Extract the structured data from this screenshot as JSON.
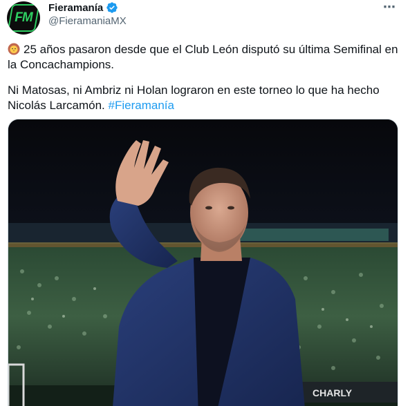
{
  "author": {
    "display_name": "Fieramanía",
    "handle": "@FieramaniaMX",
    "avatar_text": "FM",
    "verified": true
  },
  "tweet": {
    "paragraph1": "25 años pasaron desde que el Club León disputó su última Semifinal en la Concachampions.",
    "paragraph2_text": "Ni Matosas, ni Ambriz ni Holan lograron en este torneo lo que ha hecho Nicolás Larcamón. ",
    "hashtag": "#Fieramanía"
  },
  "media": {
    "banner_text": "CHARLY"
  },
  "icons": {
    "more": "more-icon",
    "verified": "verified-badge-icon",
    "emoji": "lion-face-emoji"
  },
  "colors": {
    "link": "#1d9bf0",
    "secondary_text": "#536471",
    "verified": "#1d9bf0",
    "brand_green": "#2ecf62"
  }
}
